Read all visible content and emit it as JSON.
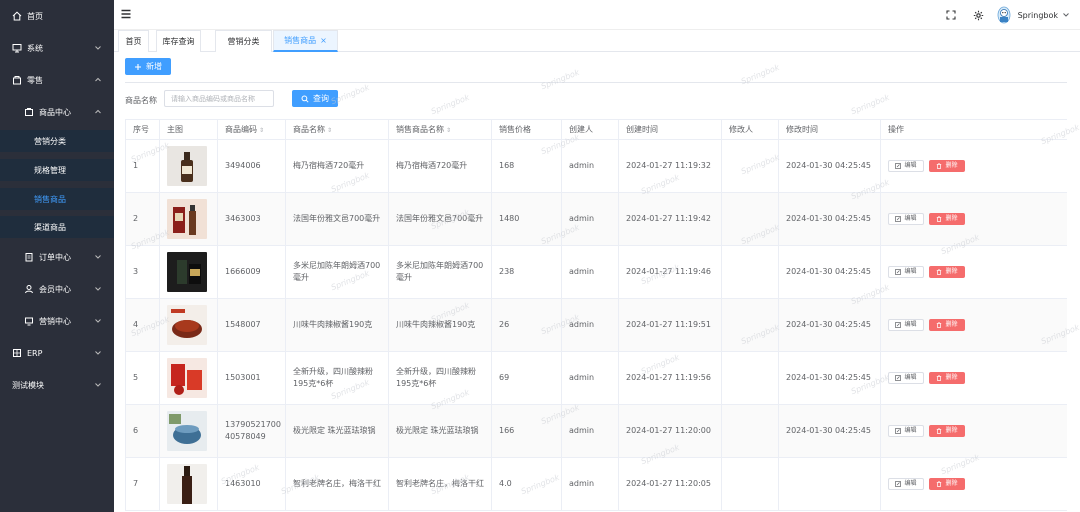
{
  "sidebar": {
    "items": [
      {
        "label": "首页",
        "icon": "home-icon"
      },
      {
        "label": "系统",
        "icon": "monitor-icon"
      },
      {
        "label": "零售",
        "icon": "shop-icon"
      },
      {
        "label": "商品中心",
        "icon": "goods-icon"
      },
      {
        "label": "营销分类"
      },
      {
        "label": "规格管理"
      },
      {
        "label": "销售商品"
      },
      {
        "label": "渠道商品"
      },
      {
        "label": "订单中心",
        "icon": "order-icon"
      },
      {
        "label": "会员中心",
        "icon": "user-icon"
      },
      {
        "label": "营销中心",
        "icon": "marketing-icon"
      },
      {
        "label": "ERP",
        "icon": "erp-icon"
      },
      {
        "label": "测试模块"
      }
    ]
  },
  "topbar": {
    "username": "Springbok"
  },
  "tabs": [
    {
      "label": "首页"
    },
    {
      "label": "库存查询"
    },
    {
      "label": "营销分类"
    },
    {
      "label": "销售商品",
      "close": "×"
    }
  ],
  "toolbar": {
    "add_label": "新增",
    "search_label": "查询"
  },
  "search": {
    "label": "商品名称",
    "placeholder": "请输入商品编码或商品名称"
  },
  "watermark": "Springbok",
  "table": {
    "headers": [
      "序号",
      "主图",
      "商品编码",
      "商品名称",
      "销售商品名称",
      "销售价格",
      "创建人",
      "创建时间",
      "修改人",
      "修改时间",
      "操作"
    ],
    "edit_label": "编辑",
    "delete_label": "删除",
    "rows": [
      {
        "no": "1",
        "code": "3494006",
        "name": "梅乃宿梅酒720毫升",
        "sale_name": "梅乃宿梅酒720毫升",
        "price": "168",
        "creator": "admin",
        "created": "2024-01-27 11:19:32",
        "modifier": "",
        "modified": "2024-01-30 04:25:45"
      },
      {
        "no": "2",
        "code": "3463003",
        "name": "法国年份雅文邑700毫升",
        "sale_name": "法国年份雅文邑700毫升",
        "price": "1480",
        "creator": "admin",
        "created": "2024-01-27 11:19:42",
        "modifier": "",
        "modified": "2024-01-30 04:25:45"
      },
      {
        "no": "3",
        "code": "1666009",
        "name": "多米尼加陈年朗姆酒700毫升",
        "sale_name": "多米尼加陈年朗姆酒700毫升",
        "price": "238",
        "creator": "admin",
        "created": "2024-01-27 11:19:46",
        "modifier": "",
        "modified": "2024-01-30 04:25:45"
      },
      {
        "no": "4",
        "code": "1548007",
        "name": "川味牛肉辣椒酱190克",
        "sale_name": "川味牛肉辣椒酱190克",
        "price": "26",
        "creator": "admin",
        "created": "2024-01-27 11:19:51",
        "modifier": "",
        "modified": "2024-01-30 04:25:45"
      },
      {
        "no": "5",
        "code": "1503001",
        "name": "全新升级，四川酸辣粉195克*6杯",
        "sale_name": "全新升级，四川酸辣粉195克*6杯",
        "price": "69",
        "creator": "admin",
        "created": "2024-01-27 11:19:56",
        "modifier": "",
        "modified": "2024-01-30 04:25:45"
      },
      {
        "no": "6",
        "code": "1379052170040578049",
        "name": "极光限定 珠光蓝珐琅锅",
        "sale_name": "极光限定 珠光蓝珐琅锅",
        "price": "166",
        "creator": "admin",
        "created": "2024-01-27 11:20:00",
        "modifier": "",
        "modified": "2024-01-30 04:25:45"
      },
      {
        "no": "7",
        "code": "1463010",
        "name": "智利老牌名庄，梅洛干红",
        "sale_name": "智利老牌名庄，梅洛干红",
        "price": "4.0",
        "creator": "admin",
        "created": "2024-01-27 11:20:05",
        "modifier": "",
        "modified": ""
      }
    ]
  }
}
